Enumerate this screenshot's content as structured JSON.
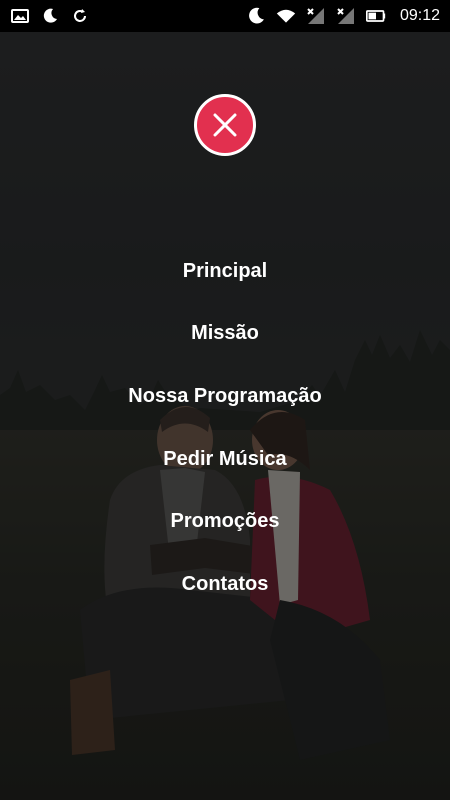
{
  "status_bar": {
    "time": "09:12",
    "left_icons": [
      "image-icon",
      "moon-icon",
      "refresh-icon"
    ],
    "right_icons": [
      "moon-icon",
      "wifi-icon",
      "signal-x-icon",
      "signal-x-icon",
      "battery-icon"
    ]
  },
  "menu": {
    "close_icon": "close-icon",
    "accent_color": "#e2304f",
    "items": [
      {
        "label": "Principal"
      },
      {
        "label": "Missão"
      },
      {
        "label": "Nossa Programação"
      },
      {
        "label": "Pedir Música"
      },
      {
        "label": "Promoções"
      },
      {
        "label": "Contatos"
      }
    ]
  }
}
